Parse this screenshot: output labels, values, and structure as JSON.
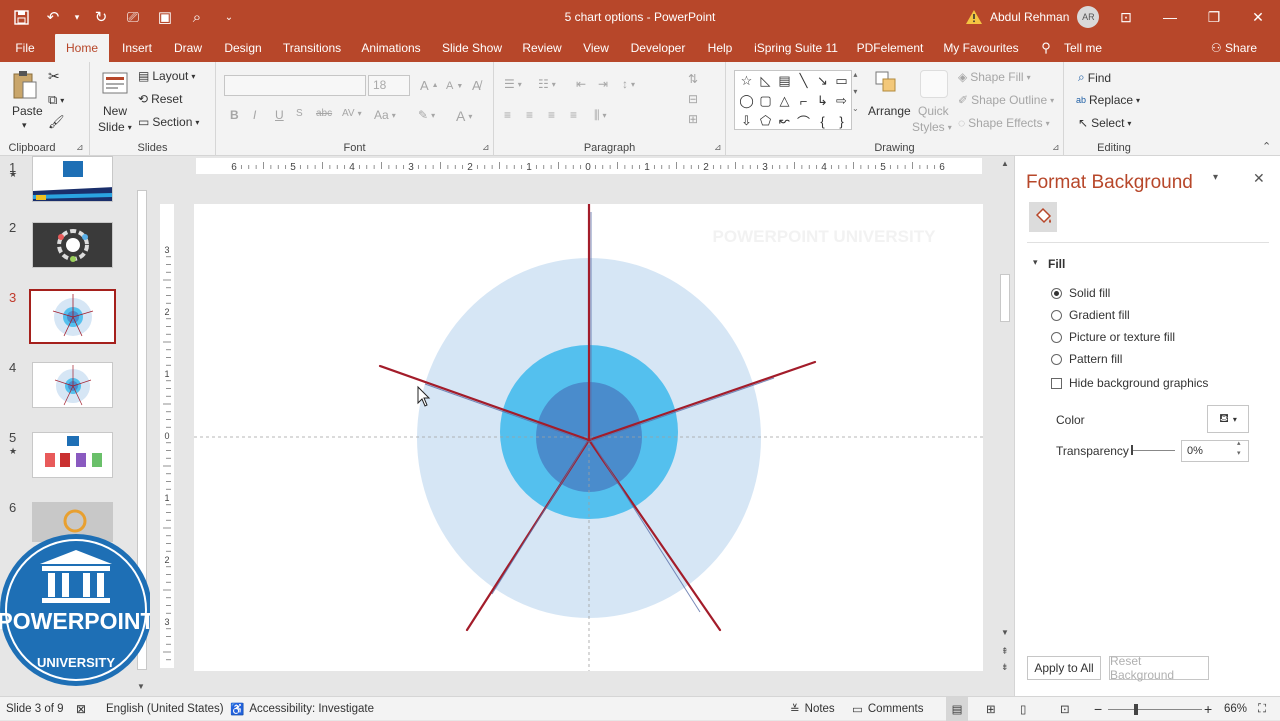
{
  "window": {
    "title": "5 chart options - PowerPoint",
    "user_name": "Abdul Rehman",
    "user_initials": "AR",
    "accent": "#b7472a"
  },
  "quick_access": [
    "save-icon",
    "undo-icon",
    "redo-icon",
    "present-icon",
    "slideshow-icon",
    "screenshot-icon",
    "customize-icon"
  ],
  "menu": {
    "tabs": [
      "File",
      "Home",
      "Insert",
      "Draw",
      "Design",
      "Transitions",
      "Animations",
      "Slide Show",
      "Review",
      "View",
      "Developer",
      "Help",
      "iSpring Suite 11",
      "PDFelement",
      "My Favourites",
      "Tell me"
    ],
    "active": "Home",
    "share": "Share"
  },
  "ribbon": {
    "clipboard": {
      "paste": "Paste",
      "label": "Clipboard"
    },
    "slides": {
      "new_slide_1": "New",
      "new_slide_2": "Slide",
      "layout": "Layout",
      "reset": "Reset",
      "section": "Section",
      "label": "Slides"
    },
    "font": {
      "size": "18",
      "bold": "B",
      "italic": "I",
      "underline": "U",
      "strike": "abc",
      "spacing": "AV",
      "case": "Aa",
      "color": "A",
      "grow": "A",
      "shrink": "A",
      "label": "Font"
    },
    "paragraph": {
      "label": "Paragraph"
    },
    "drawing": {
      "arrange": "Arrange",
      "quick_styles_1": "Quick",
      "quick_styles_2": "Styles",
      "shape_fill": "Shape Fill",
      "shape_outline": "Shape Outline",
      "shape_effects": "Shape Effects",
      "label": "Drawing"
    },
    "editing": {
      "find": "Find",
      "replace": "Replace",
      "select": "Select",
      "label": "Editing"
    }
  },
  "thumbnails": {
    "numbers": [
      "1",
      "2",
      "3",
      "4",
      "5",
      "6"
    ],
    "starred": [
      "1",
      "5"
    ],
    "active": "3"
  },
  "ruler": {
    "h_ticks": [
      "6",
      "5",
      "4",
      "3",
      "2",
      "1",
      "0",
      "1",
      "2",
      "3",
      "4",
      "5",
      "6"
    ],
    "v_ticks": [
      "3",
      "2",
      "1",
      "0",
      "1",
      "2",
      "3"
    ]
  },
  "slide": {
    "watermark": "POWERPOINT UNIVERSITY",
    "circle_colors": {
      "outer": "#d6e6f5",
      "middle": "#54c0ee",
      "inner": "#4a8ccc"
    },
    "line_color": "#a31c2a"
  },
  "logo": {
    "text_main": "POWERPOINT",
    "text_sub": "UNIVERSITY",
    "color": "#1e6fb5"
  },
  "format_background": {
    "title": "Format Background",
    "section": "Fill",
    "options": [
      "Solid fill",
      "Gradient fill",
      "Picture or texture fill",
      "Pattern fill"
    ],
    "selected": "Solid fill",
    "hide_graphics": "Hide background graphics",
    "color_label": "Color",
    "transparency_label": "Transparency",
    "transparency_value": "0%",
    "apply_all": "Apply to All",
    "reset_bg": "Reset Background"
  },
  "status": {
    "slide_info": "Slide 3 of 9",
    "language": "English (United States)",
    "accessibility": "Accessibility: Investigate",
    "notes": "Notes",
    "comments": "Comments",
    "zoom": "66%"
  }
}
